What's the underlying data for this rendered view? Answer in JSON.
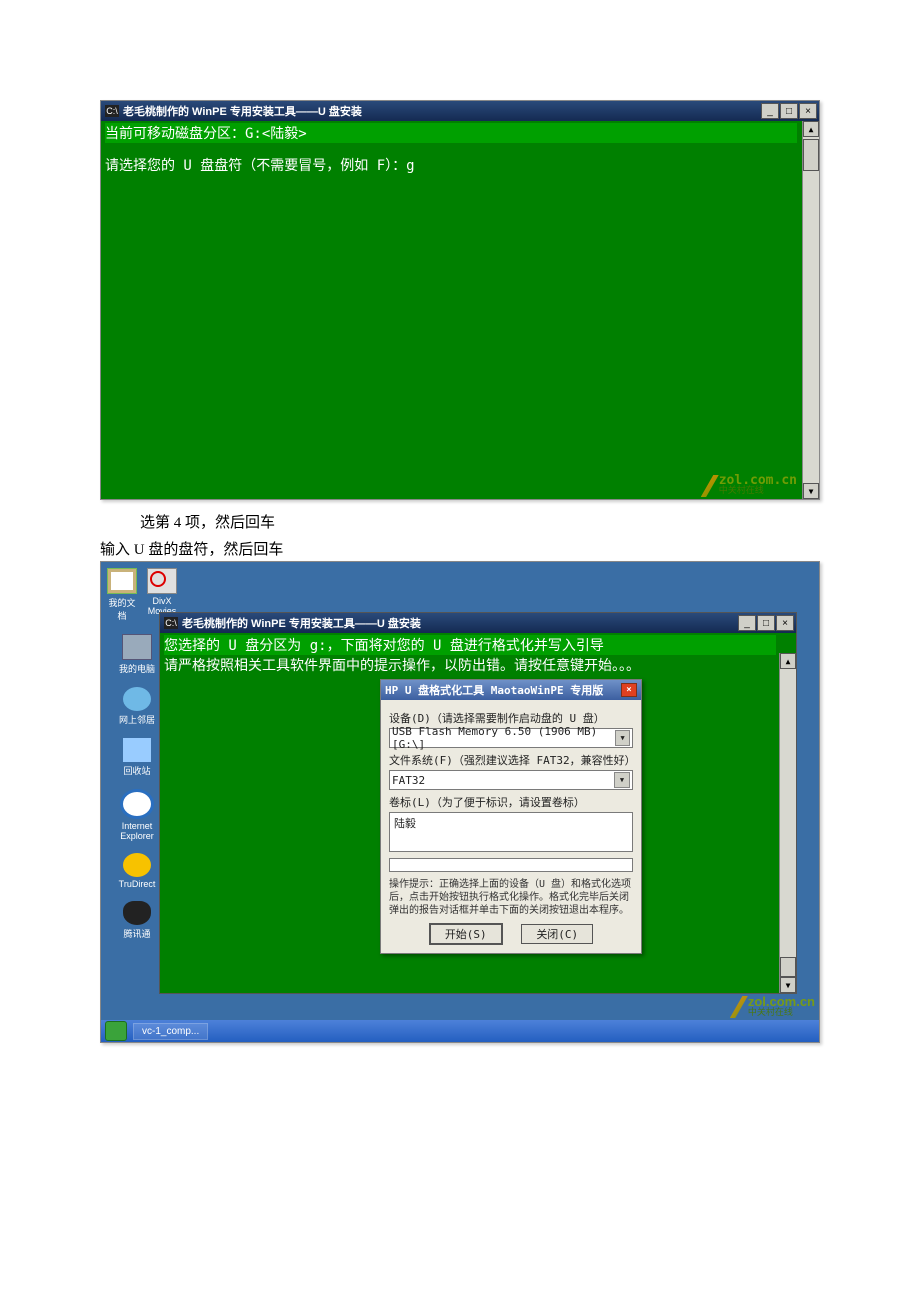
{
  "window1": {
    "title": "老毛桃制作的 WinPE 专用安装工具——U 盘安装",
    "logo": "C:\\",
    "lines": {
      "l1": "当前可移动磁盘分区：G:<陆毅>",
      "l2": "请选择您的 U 盘盘符（不需要冒号，例如 F）：g"
    },
    "controls": {
      "min": "_",
      "max": "□",
      "close": "×"
    },
    "scroll": {
      "up": "▲",
      "down": "▼"
    }
  },
  "captions": {
    "c1": "选第 4 项，然后回车",
    "c2": "输入 U 盘的盘符，然后回车"
  },
  "desktop": {
    "icons": {
      "docs": "我的文档",
      "movies": "DivX Movies",
      "pc": "我的电脑",
      "net": "网上邻居",
      "bin": "回收站",
      "ie": "Internet Explorer",
      "dvd": "TruDirect",
      "qq": "腾讯通"
    },
    "task": "vc-1_comp..."
  },
  "window2": {
    "title": "老毛桃制作的 WinPE 专用安装工具——U 盘安装",
    "lines": {
      "l1": "您选择的 U 盘分区为 g:，下面将对您的 U 盘进行格式化并写入引导",
      "l2": "请严格按照相关工具软件界面中的提示操作，以防出错。请按任意键开始。。。"
    },
    "controls": {
      "min": "_",
      "max": "□",
      "close": "×"
    }
  },
  "dialog": {
    "title": "HP U 盘格式化工具 MaotaoWinPE 专用版",
    "close": "×",
    "device_label": "设备(D)（请选择需要制作启动盘的 U 盘）",
    "device_value": "USB Flash Memory 6.50 (1906 MB) [G:\\]",
    "fs_label": "文件系统(F)（强烈建议选择 FAT32，兼容性好）",
    "fs_value": "FAT32",
    "vol_label": "卷标(L)（为了便于标识，请设置卷标）",
    "vol_value": "陆毅",
    "hint": "操作提示：正确选择上面的设备（U 盘）和格式化选项后，点击开始按钮执行格式化操作。格式化完毕后关闭弹出的报告对话框并单击下面的关闭按钮退出本程序。",
    "start": "开始(S)",
    "close_btn": "关闭(C)"
  },
  "watermark": {
    "top": "zol.com.cn",
    "bottom": "中关村在线"
  }
}
